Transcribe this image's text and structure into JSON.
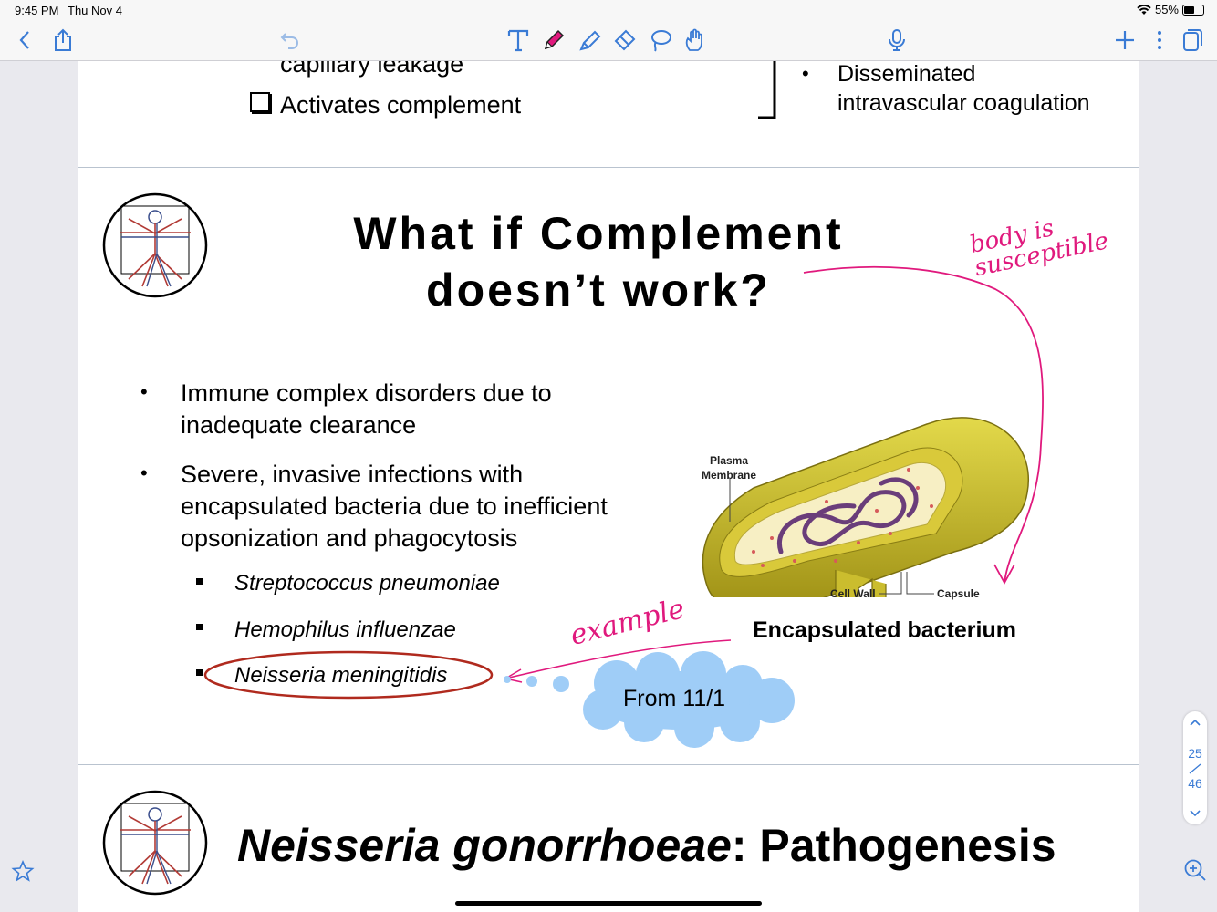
{
  "status_bar": {
    "time": "9:45 PM",
    "date": "Thu Nov 4",
    "battery": "55%"
  },
  "toolbar": {
    "icons": [
      "back-chevron-icon",
      "share-icon",
      "undo-icon",
      "text-tool-icon",
      "pen-tool-icon",
      "highlighter-tool-icon",
      "eraser-tool-icon",
      "lasso-tool-icon",
      "hand-tool-icon",
      "microphone-icon",
      "add-page-icon",
      "more-icon",
      "pages-icon"
    ],
    "pen_color": "#e0197d"
  },
  "prev_slide": {
    "line1": "capillary leakage",
    "line2": "Activates complement",
    "right_bullet_1": "Disseminated",
    "right_bullet_2": "intravascular coagulation"
  },
  "slide": {
    "title_line1": "What if Complement",
    "title_line2": "doesn’t work?",
    "bullets": [
      {
        "line1": "Immune complex disorders due to",
        "line2": "inadequate clearance"
      },
      {
        "line1": "Severe, invasive infections with",
        "line2": "encapsulated bacteria due to inefficient",
        "line3": "opsonization and phagocytosis"
      }
    ],
    "sub_bullets": [
      "Streptococcus pneumoniae",
      "Hemophilus influenzae",
      "Neisseria meningitidis"
    ],
    "figure": {
      "caption": "Encapsulated bacterium",
      "label_plasma_1": "Plasma",
      "label_plasma_2": "Membrane",
      "label_cell_wall": "Cell Wall",
      "label_capsule": "Capsule"
    },
    "handwriting": {
      "top_right": "body is susceptible",
      "example": "example"
    },
    "thought_bubble": "From 11/1"
  },
  "next_slide": {
    "title_italic": "Neisseria gonorrhoeae",
    "title_rest": ": Pathogenesis"
  },
  "page_nav": {
    "current": "25",
    "total": "46"
  },
  "colors": {
    "accent": "#3a7bd5",
    "ink_pink": "#e0197d",
    "circle_red": "#b02a1e",
    "bubble_blue": "#9fcdf7"
  }
}
